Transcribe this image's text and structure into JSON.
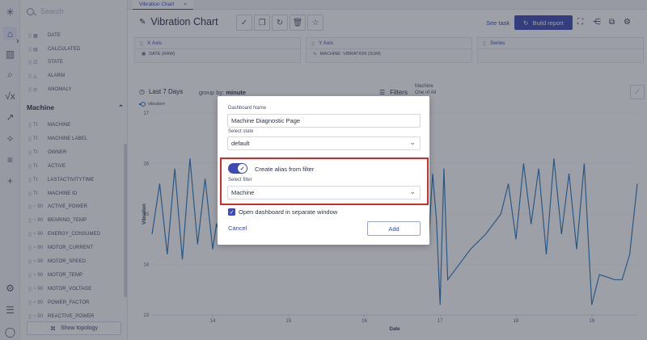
{
  "tab": {
    "label": "Vibration Chart",
    "close": "×"
  },
  "header": {
    "title": "Vibration Chart",
    "see_task": "See task",
    "build_report": "Build report"
  },
  "sidebar": {
    "search_placeholder": "Search",
    "top_items": [
      {
        "label": "DATE",
        "icon": "calendar-icon"
      },
      {
        "label": "CALCULATED",
        "icon": "grid-icon"
      },
      {
        "label": "STATE",
        "icon": "state-icon"
      },
      {
        "label": "ALARM",
        "icon": "alarm-icon"
      },
      {
        "label": "ANOMALY",
        "icon": "anomaly-icon"
      }
    ],
    "section_title": "Machine",
    "section_items": [
      {
        "label": "MACHINE",
        "type": "Tt"
      },
      {
        "label": "MACHINE LABEL",
        "type": "Tt"
      },
      {
        "label": "OWNER",
        "type": "Tt"
      },
      {
        "label": "ACTIVE",
        "type": "Tt"
      },
      {
        "label": "LASTACTIVITYTIME",
        "type": "Tt"
      },
      {
        "label": "MACHINE ID",
        "type": "Tt"
      },
      {
        "label": "ACTIVE_POWER",
        "type": "~ 90"
      },
      {
        "label": "BEARING_TEMP",
        "type": "~ 90"
      },
      {
        "label": "ENERGY_CONSUMED",
        "type": "~ 90"
      },
      {
        "label": "MOTOR_CURRENT",
        "type": "~ 90"
      },
      {
        "label": "MOTOR_SPEED",
        "type": "~ 90"
      },
      {
        "label": "MOTOR_TEMP",
        "type": "~ 90"
      },
      {
        "label": "MOTOR_VOLTAGE",
        "type": "~ 90"
      },
      {
        "label": "POWER_FACTOR",
        "type": "~ 90"
      },
      {
        "label": "REACTIVE_POWER",
        "type": "~ 90"
      }
    ],
    "show_topology": "Show topology"
  },
  "axes": {
    "x_title": "X Axis",
    "x_value": "DATE (RAW)",
    "y_title": "Y Axis",
    "y_value": "MACHINE: VIBRATION (SUM)",
    "series_title": "Series"
  },
  "chart_header": {
    "range": "Last 7 Days",
    "group_by_label": "group by:",
    "group_by_value": "minute",
    "filters": "Filters",
    "filter_name": "Machine",
    "filter_value": "One of  All"
  },
  "modal": {
    "dashboard_name_label": "Dashboard Name",
    "dashboard_name_value": "Machine Diagnostic Page",
    "select_state_label": "Select state",
    "select_state_value": "default",
    "alias_toggle_label": "Create alias from filter",
    "select_filter_label": "Select filter",
    "select_filter_value": "Machine",
    "separate_window_label": "Open dashboard in separate window",
    "cancel": "Cancel",
    "add": "Add"
  },
  "colors": {
    "accent": "#3e4bb5",
    "series": "#2e7bbf",
    "highlight": "#d62a2a"
  },
  "chart_data": {
    "type": "line",
    "xlabel": "Date",
    "ylabel": "Vibration",
    "ylim": [
      13,
      17
    ],
    "xlim": [
      13.2,
      19.6
    ],
    "x_ticks": [
      "14",
      "15",
      "16",
      "17",
      "18",
      "19"
    ],
    "y_ticks": [
      "13",
      "14",
      "15",
      "16",
      "17"
    ],
    "series": [
      {
        "name": "vibration",
        "x": [
          13.2,
          13.3,
          13.4,
          13.5,
          13.6,
          13.7,
          13.8,
          13.9,
          14.0,
          14.05,
          14.1,
          14.2,
          14.3,
          14.4,
          14.5,
          14.6,
          14.7,
          14.8,
          14.9,
          15.0,
          16.8,
          16.85,
          16.9,
          16.95,
          17.0,
          17.05,
          17.1,
          17.2,
          17.4,
          17.6,
          17.8,
          17.9,
          18.0,
          18.1,
          18.2,
          18.3,
          18.4,
          18.5,
          18.6,
          18.7,
          18.8,
          18.9,
          19.0,
          19.1,
          19.2,
          19.3,
          19.4,
          19.5,
          19.6
        ],
        "y": [
          14.6,
          15.6,
          14.2,
          15.9,
          14.1,
          16.1,
          14.4,
          15.7,
          14.3,
          14.8,
          14.6,
          14.65,
          14.7,
          14.8,
          14.65,
          14.7,
          14.7,
          14.75,
          14.7,
          15.2,
          16.0,
          14.5,
          15.8,
          14.9,
          13.2,
          15.9,
          13.7,
          13.9,
          14.3,
          14.6,
          15.0,
          15.6,
          14.5,
          16.0,
          14.8,
          15.9,
          14.2,
          16.1,
          14.6,
          15.8,
          14.3,
          16.0,
          13.2,
          13.8,
          13.75,
          13.7,
          13.7,
          14.2,
          15.6
        ]
      }
    ]
  }
}
